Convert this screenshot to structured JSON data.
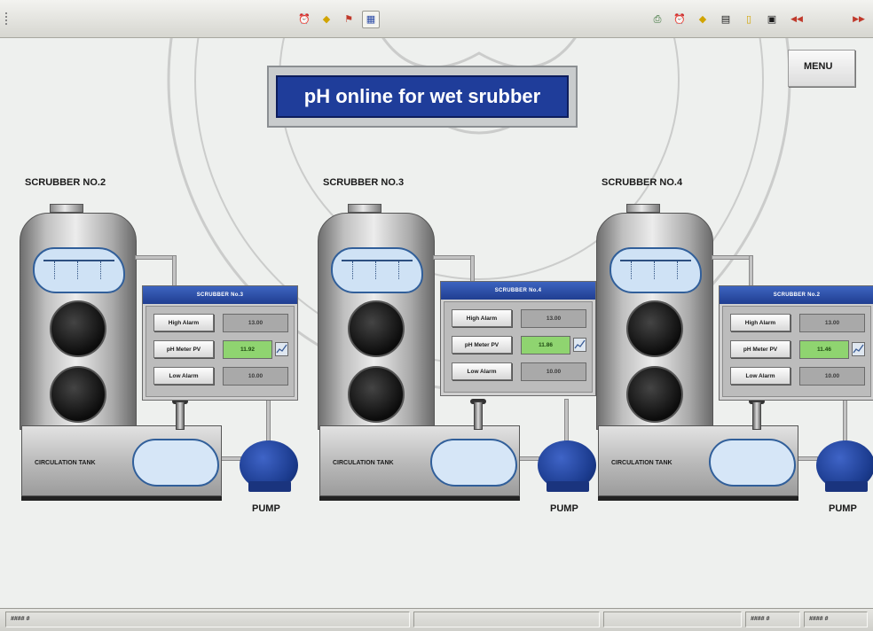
{
  "toolbar": {
    "left_buttons": [
      {
        "name": "alarm-clock-icon",
        "glyph": "⏰"
      },
      {
        "name": "diamond-icon",
        "glyph": "◆"
      },
      {
        "name": "flag-icon",
        "glyph": "⚑"
      },
      {
        "name": "chart-icon",
        "glyph": "▦"
      }
    ],
    "right_buttons": [
      {
        "name": "print-icon",
        "glyph": "⎙"
      },
      {
        "name": "clock-icon",
        "glyph": "⏰"
      },
      {
        "name": "diamond-icon",
        "glyph": "◆"
      },
      {
        "name": "document-icon",
        "glyph": "▤"
      },
      {
        "name": "page-icon",
        "glyph": "▯"
      },
      {
        "name": "save-icon",
        "glyph": "▣"
      },
      {
        "name": "rewind-icon",
        "glyph": "◀◀"
      },
      {
        "name": "fast-forward-icon",
        "glyph": "▶▶"
      }
    ],
    "accent_color": "#c0392b"
  },
  "header": {
    "title": "pH online for wet srubber",
    "menu_label": "MENU"
  },
  "units": [
    {
      "label": "SCRUBBER NO.2",
      "tank_label": "CIRCULATION TANK",
      "pump_label": "PUMP",
      "panel": {
        "title": "SCRUBBER No.3",
        "high_alarm_label": "High Alarm",
        "high_alarm_value": "13.00",
        "pv_label": "pH Meter PV",
        "pv_value": "11.92",
        "low_alarm_label": "Low Alarm",
        "low_alarm_value": "10.00"
      }
    },
    {
      "label": "SCRUBBER NO.3",
      "tank_label": "CIRCULATION TANK",
      "pump_label": "PUMP",
      "panel": {
        "title": "SCRUBBER No.4",
        "high_alarm_label": "High Alarm",
        "high_alarm_value": "13.00",
        "pv_label": "pH Meter PV",
        "pv_value": "11.86",
        "low_alarm_label": "Low Alarm",
        "low_alarm_value": "10.00"
      }
    },
    {
      "label": "SCRUBBER NO.4",
      "tank_label": "CIRCULATION TANK",
      "pump_label": "PUMP",
      "panel": {
        "title": "SCRUBBER No.2",
        "high_alarm_label": "High Alarm",
        "high_alarm_value": "13.00",
        "pv_label": "pH Meter PV",
        "pv_value": "11.46",
        "low_alarm_label": "Low Alarm",
        "low_alarm_value": "10.00"
      }
    }
  ],
  "statusbar": {
    "left": "#### #",
    "mid": "#### #",
    "right": "#### #"
  },
  "colors": {
    "title_bg": "#1f3d9a",
    "panel_head": "#2a4aa6",
    "pv_green": "#8fd470",
    "pump_blue": "#1b3b8e",
    "spray_blue": "#cfe2f5"
  }
}
